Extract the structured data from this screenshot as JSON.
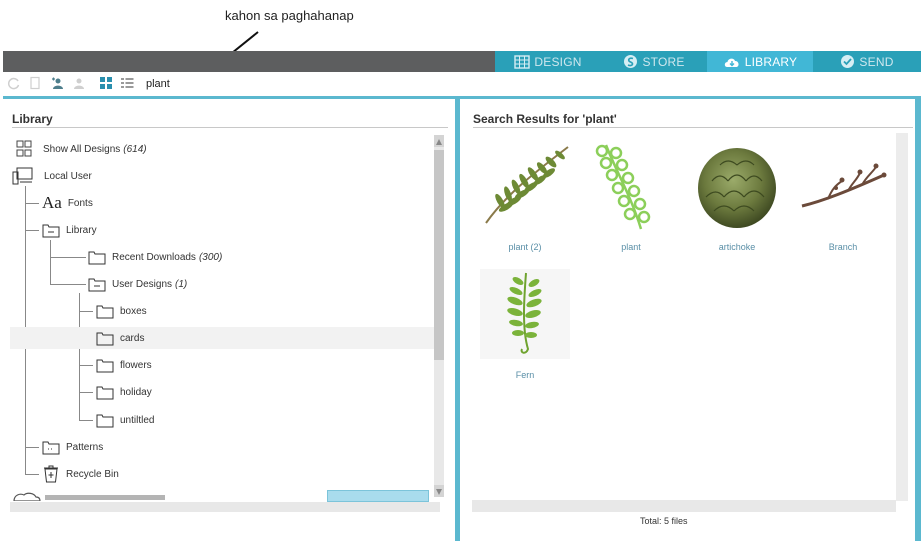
{
  "annotation": {
    "label": "kahon sa paghahanap"
  },
  "nav": {
    "tabs": [
      {
        "label": "DESIGN",
        "icon": "grid-icon"
      },
      {
        "label": "STORE",
        "icon": "store-icon"
      },
      {
        "label": "LIBRARY",
        "icon": "cloud-icon",
        "active": true
      },
      {
        "label": "SEND",
        "icon": "check-icon"
      }
    ]
  },
  "toolbar": {
    "search_value": "plant",
    "icons": [
      "refresh-icon",
      "new-folder-icon",
      "add-user-icon",
      "remove-user-icon",
      "grid-view-icon",
      "list-view-icon"
    ]
  },
  "library": {
    "title": "Library",
    "tree": [
      {
        "label": "Show All Designs",
        "count": "(614)",
        "icon": "grid-icon"
      },
      {
        "label": "Local User",
        "icon": "computer-icon"
      },
      {
        "label": "Fonts",
        "icon": "font-icon"
      },
      {
        "label": "Library",
        "icon": "folder-icon"
      },
      {
        "label": "Recent Downloads",
        "count": "(300)",
        "icon": "folder-icon"
      },
      {
        "label": "User Designs",
        "count": "(1)",
        "icon": "folder-icon"
      },
      {
        "label": "boxes",
        "icon": "folder-icon"
      },
      {
        "label": "cards",
        "icon": "folder-icon"
      },
      {
        "label": "flowers",
        "icon": "folder-icon"
      },
      {
        "label": "holiday",
        "icon": "folder-icon"
      },
      {
        "label": "untiltled",
        "icon": "folder-icon"
      },
      {
        "label": "Patterns",
        "icon": "folder-icon"
      },
      {
        "label": "Recycle Bin",
        "icon": "trash-icon"
      }
    ]
  },
  "results": {
    "title": "Search Results for 'plant'",
    "items": [
      {
        "label": "plant (2)"
      },
      {
        "label": "plant"
      },
      {
        "label": "artichoke"
      },
      {
        "label": "Branch"
      },
      {
        "label": "Fern"
      }
    ],
    "total": "Total: 5 files"
  },
  "colors": {
    "accent": "#2aa0b8",
    "active_tab": "#41b7d6",
    "topbar": "#5d5e5f",
    "panel_border": "#5bb8cf"
  }
}
